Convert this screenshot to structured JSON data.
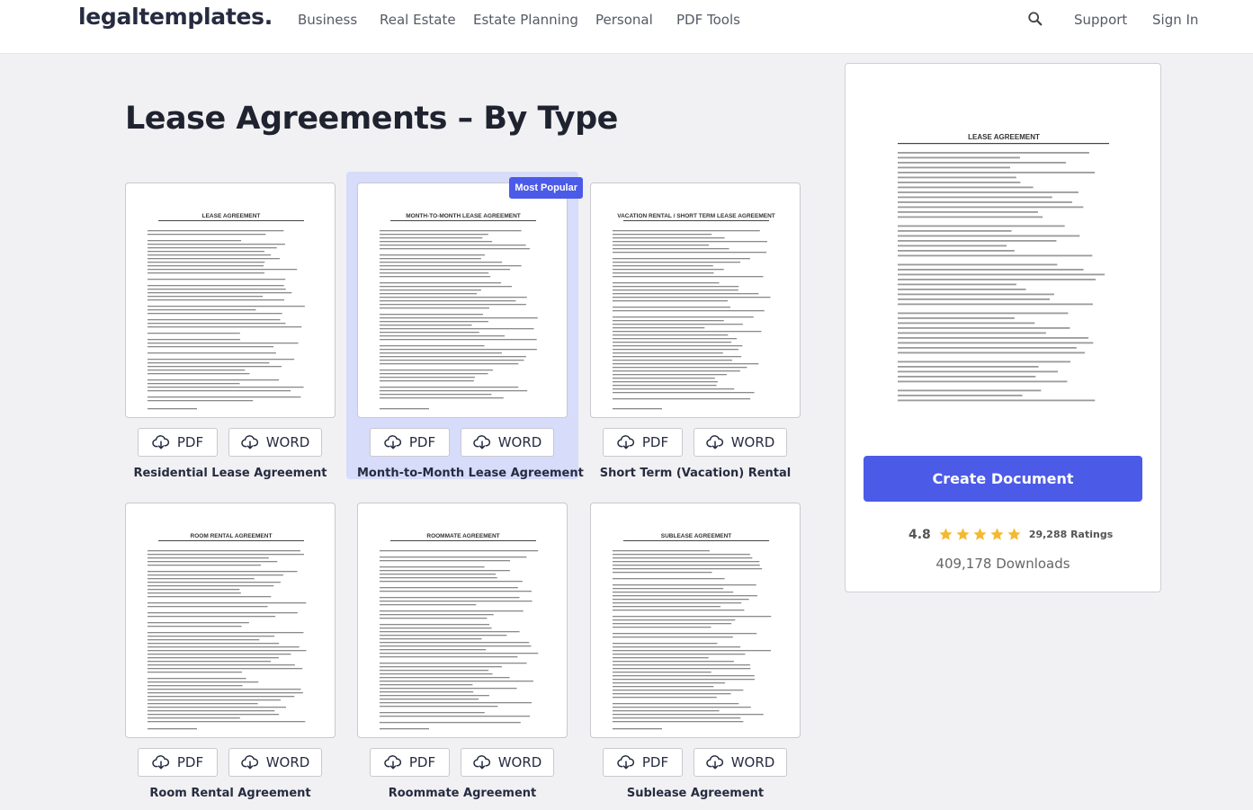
{
  "header": {
    "logo": "legaltemplates.",
    "nav": [
      "Business",
      "Real Estate",
      "Estate Planning",
      "Personal",
      "PDF Tools"
    ],
    "support": "Support",
    "sign_in": "Sign In"
  },
  "page_title": "Lease Agreements – By Type",
  "buttons": {
    "pdf": "PDF",
    "word": "WORD"
  },
  "cards": [
    {
      "title": "Residential Lease Agreement",
      "doc_heading": "LEASE AGREEMENT",
      "popular": false
    },
    {
      "title": "Month-to-Month Lease Agreement",
      "doc_heading": "MONTH-TO-MONTH LEASE AGREEMENT",
      "popular": true,
      "badge": "Most Popular"
    },
    {
      "title": "Short Term (Vacation) Rental",
      "doc_heading": "VACATION RENTAL / SHORT TERM LEASE AGREEMENT",
      "popular": false
    },
    {
      "title": "Room Rental Agreement",
      "doc_heading": "ROOM RENTAL AGREEMENT",
      "popular": false
    },
    {
      "title": "Roommate Agreement",
      "doc_heading": "ROOMMATE AGREEMENT",
      "popular": false
    },
    {
      "title": "Sublease Agreement",
      "doc_heading": "SUBLEASE AGREEMENT",
      "popular": false
    }
  ],
  "side_panel": {
    "doc_heading": "LEASE AGREEMENT",
    "create_button": "Create Document",
    "rating_value": "4.8",
    "stars": 5,
    "rating_count": "29,288 Ratings",
    "downloads": "409,178 Downloads"
  },
  "colors": {
    "accent": "#4c5ae8",
    "star": "#f5b82e",
    "popular_bg": "#d6dcfa"
  },
  "icons": {
    "search": "search-icon",
    "download": "download-icon",
    "star": "star-icon"
  }
}
